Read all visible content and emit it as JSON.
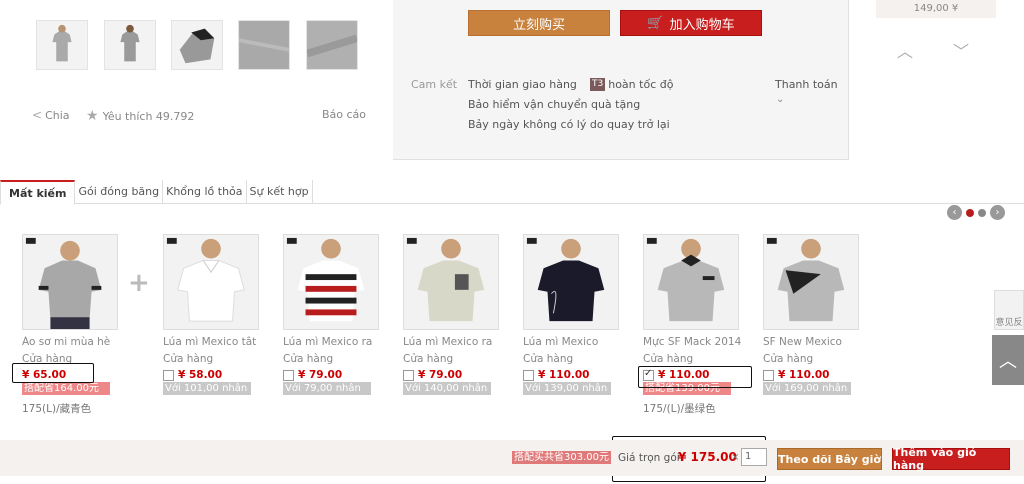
{
  "gallery": {
    "share_label": "Chia",
    "like_label": "Yêu thích 49.792",
    "report_label": "Báo cáo"
  },
  "purchase": {
    "buy_now": "立刻购买",
    "add_to_cart": "加入购物车",
    "promise_label": "Cam kết",
    "promises": [
      "Thời gian giao hàng",
      "Bảo hiểm vận chuyển quà tặng",
      "Bảy ngày không có lý do quay trở lại"
    ],
    "speed_badge": "T3",
    "speed_text": "hoàn tốc độ",
    "payment_label": "Thanh toán"
  },
  "side_recommend": {
    "price": "149,00 ¥"
  },
  "tabs": [
    "Mất kiếm",
    "Gói đóng băng",
    "Khổng lồ thỏa",
    "Sự kết hợp"
  ],
  "products": [
    {
      "name": "Áo sơ mi mùa hè",
      "store": "Cửa hàng",
      "price": "¥ 65.00",
      "sub": "搭配省164.00元",
      "sub_red": true,
      "sku": "175(L)/藏青色",
      "checkbox": false,
      "main": true
    },
    {
      "name": "Lúa mì Mexico tắt",
      "store": "Cửa hàng",
      "price": "¥ 58.00",
      "sub": "Với 101,00 nhân",
      "sub_red": false,
      "sku": "",
      "checkbox": true,
      "checked": false
    },
    {
      "name": "Lúa mì Mexico ra",
      "store": "Cửa hàng",
      "price": "¥ 79.00",
      "sub": "Với 79,00 nhân",
      "sub_red": false,
      "sku": "",
      "checkbox": true,
      "checked": false
    },
    {
      "name": "Lúa mì Mexico ra",
      "store": "Cửa hàng",
      "price": "¥ 79.00",
      "sub": "Với 140,00 nhân",
      "sub_red": false,
      "sku": "",
      "checkbox": true,
      "checked": false
    },
    {
      "name": "Lúa mì Mexico",
      "store": "Cửa hàng",
      "price": "¥ 110.00",
      "sub": "Với 139,00 nhân",
      "sub_red": false,
      "sku": "",
      "checkbox": true,
      "checked": false
    },
    {
      "name": "Mực SF Mack 2014",
      "store": "Cửa hàng",
      "price": "¥ 110.00",
      "sub": "搭配省139.00元",
      "sub_red": true,
      "sku": "175/(L)/墨绿色",
      "checkbox": true,
      "checked": true
    },
    {
      "name": "SF New Mexico",
      "store": "Cửa hàng",
      "price": "¥ 110.00",
      "sub": "Với 169,00 nhân",
      "sub_red": false,
      "sku": "",
      "checkbox": true,
      "checked": false
    }
  ],
  "bundle": {
    "combo_total": "搭配买共省303.00元",
    "package_label": "Giá trọn gói:",
    "package_price": "¥ 175.00",
    "multiply": "×",
    "quantity": "1",
    "follow_button": "Theo dõi Bây giờ",
    "add_button": "Thêm vào giỏ hàng"
  },
  "side_widgets": {
    "feedback": "意见反"
  },
  "colors": {
    "orange": "#c8823e",
    "red": "#c81e1e",
    "price_red": "#cc0000"
  },
  "icons": [
    "share-icon",
    "star-icon",
    "cart-icon",
    "chevron-up-icon",
    "chevron-down-icon",
    "chevron-left-icon",
    "chevron-right-icon",
    "back-to-top-icon"
  ]
}
